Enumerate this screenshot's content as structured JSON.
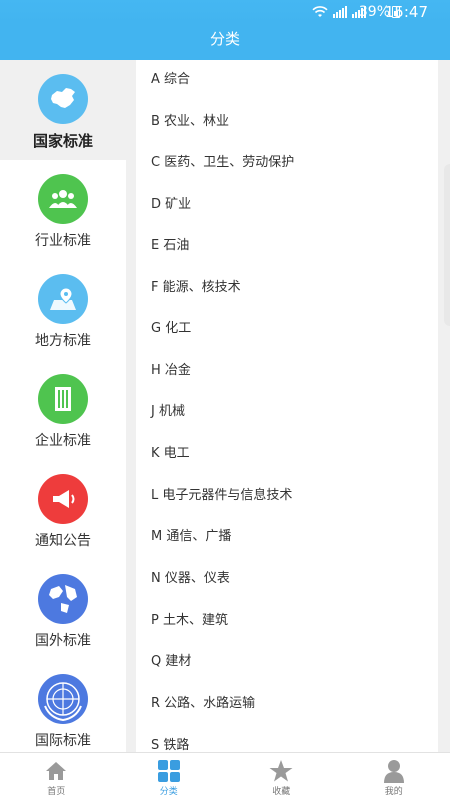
{
  "status_bar": {
    "battery": "39%",
    "time": "15:47",
    "icons": [
      "wifi-icon",
      "signal-icon",
      "signal-icon",
      "battery-icon"
    ]
  },
  "title": "分类",
  "sidebar": {
    "items": [
      {
        "label": "国家标准",
        "icon": "china-map-icon",
        "color": "#5bbdf0",
        "active": true
      },
      {
        "label": "行业标准",
        "icon": "group-icon",
        "color": "#4fc44f"
      },
      {
        "label": "地方标准",
        "icon": "map-pin-icon",
        "color": "#5bbdf0"
      },
      {
        "label": "企业标准",
        "icon": "building-icon",
        "color": "#4fc44f"
      },
      {
        "label": "通知公告",
        "icon": "megaphone-icon",
        "color": "#ee3c3c"
      },
      {
        "label": "国外标准",
        "icon": "globe-icon",
        "color": "#4d79e0"
      },
      {
        "label": "国际标准",
        "icon": "un-emblem-icon",
        "color": "#4d79e0"
      }
    ]
  },
  "categories": [
    "A 综合",
    "B 农业、林业",
    "C 医药、卫生、劳动保护",
    "D 矿业",
    "E 石油",
    "F 能源、核技术",
    "G 化工",
    "H 冶金",
    "J 机械",
    "K 电工",
    "L 电子元器件与信息技术",
    "M 通信、广播",
    "N 仪器、仪表",
    "P 土木、建筑",
    "Q 建材",
    "R 公路、水路运输",
    "S 铁路"
  ],
  "tabs": [
    {
      "label": "首页",
      "icon": "home-icon"
    },
    {
      "label": "分类",
      "icon": "grid-icon",
      "active": true
    },
    {
      "label": "收藏",
      "icon": "star-icon"
    },
    {
      "label": "我的",
      "icon": "person-icon"
    }
  ],
  "colors": {
    "primary": "#42b4f0",
    "tab_active": "#3a9de0",
    "tab_inactive": "#999999"
  }
}
